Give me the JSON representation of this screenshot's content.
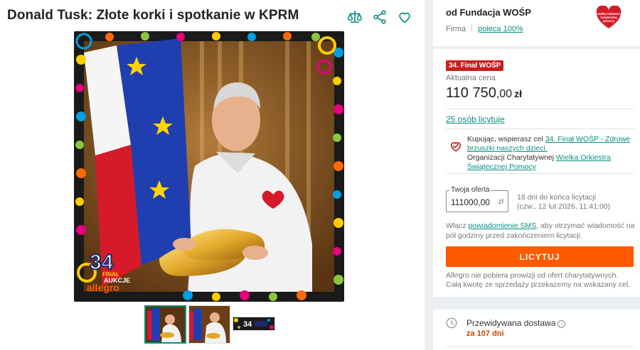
{
  "product": {
    "title": "Donald Tusk: Złote korki i spotkanie w KPRM"
  },
  "icons": {
    "compare": "scales-icon",
    "share": "share-icon",
    "favorite": "heart-icon"
  },
  "gallery": {
    "logo_number": "34",
    "logo_line": "FINAŁ",
    "logo_aukcje": "AUKCJE",
    "logo_brand": "allegro"
  },
  "seller": {
    "name": "od Fundacja WOŚP",
    "type": "Firma",
    "recommend": "poleca 100%",
    "logo_text": "wielka orkiestra świątecznej pomocy"
  },
  "offer": {
    "badge": "34. Finał WOŚP",
    "price_label": "Aktualna cena",
    "price_whole": "110 750",
    "price_decimal": ",00",
    "currency": "zł",
    "bidders": "25 osób licytuje",
    "charity_prefix": "Kupując, wspierasz cel ",
    "charity_goal": "34. Finał WOŚP - Zdrowe brzuszki naszych dzieci.",
    "charity_org_prefix": "Organizacji Charytatywnej ",
    "charity_org": "Wielka Orkiestra Świątecznej Pomocy",
    "bid_label": "Twoja oferta",
    "bid_value": "111000,00",
    "bid_unit": "zł",
    "ends_line1": "18 dni do końca licytacji",
    "ends_line2": "(czw., 12 lut 2026, 11:41:00)",
    "sms_prefix": "Włącz ",
    "sms_link": "powiadomienie SMS",
    "sms_suffix": ", aby otrzymać wiadomość na pół godziny przed zakończeniem licytacji.",
    "cta": "LICYTUJ",
    "fee_note": "Allegro nie pobiera prowizji od ofert charytatywnych. Całą kwotę ze sprzedaży przekażemy na wskazany cel."
  },
  "delivery": {
    "label": "Przewidywana dostawa",
    "days": "za 107 dni"
  },
  "colors": {
    "accent": "#0a8f80",
    "cta": "#ff5a00",
    "badge": "#c81e1e"
  }
}
